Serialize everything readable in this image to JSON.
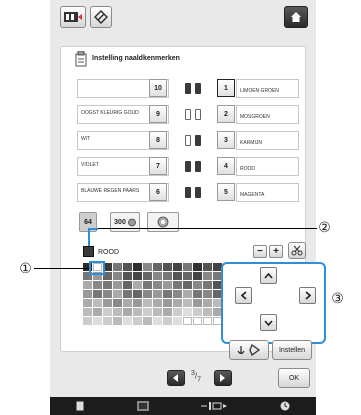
{
  "header": {
    "title": "Instelling naaldkenmerken"
  },
  "rows": [
    {
      "left_label": "",
      "left_num": "10",
      "right_num": "1",
      "right_label": "LIMOEN GROEN",
      "spools": [
        "dark",
        "dark"
      ]
    },
    {
      "left_label": "OOGST KLEURIG GOUD",
      "left_num": "9",
      "right_num": "2",
      "right_label": "MOSGROEN",
      "spools": [
        "light",
        "light"
      ]
    },
    {
      "left_label": "WIT",
      "left_num": "8",
      "right_num": "3",
      "right_label": "KARMIJN",
      "spools": [
        "light",
        "dark"
      ]
    },
    {
      "left_label": "VIOLET",
      "left_num": "7",
      "right_num": "4",
      "right_label": "ROOD",
      "spools": [
        "dark",
        "dark"
      ]
    },
    {
      "left_label": "BLAUWE REGEN PAARS",
      "left_num": "6",
      "right_num": "5",
      "right_label": "MAGENTA",
      "spools": [
        "dark",
        "dark"
      ]
    }
  ],
  "tabs": {
    "tab1": "64",
    "tab2": "300"
  },
  "selected_color": "ROOD",
  "buttons": {
    "minus": "−",
    "plus": "+",
    "instellen": "Instellen",
    "ok": "OK"
  },
  "pagination": {
    "current": "3",
    "total": "7"
  },
  "callouts": {
    "c1": "①",
    "c2": "②",
    "c3": "③"
  },
  "colors": {
    "accent_blue": "#2e8fd6",
    "selected_swatch": "#3a3a3a"
  },
  "palette": [
    "#2b2b2b",
    "#ffffff",
    "#3a3a3a",
    "#777777",
    "#555555",
    "#2e2e2e",
    "#888888",
    "#666666",
    "#555555",
    "#444444",
    "#777777",
    "#333333",
    "#555555",
    "#444444",
    "#777777",
    "#999999",
    "#666666",
    "#888888",
    "#555555",
    "#444444",
    "#666666",
    "#888888",
    "#777777",
    "#555555",
    "#666666",
    "#444444",
    "#888888",
    "#777777",
    "#aaaaaa",
    "#888888",
    "#777777",
    "#999999",
    "#666666",
    "#aaaaaa",
    "#777777",
    "#888888",
    "#999999",
    "#777777",
    "#666666",
    "#888888",
    "#777777",
    "#555555",
    "#999999",
    "#777777",
    "#888888",
    "#aaaaaa",
    "#777777",
    "#666666",
    "#888888",
    "#999999",
    "#777777",
    "#888888",
    "#aaaaaa",
    "#777777",
    "#888888",
    "#666666",
    "#aaaaaa",
    "#bbbbbb",
    "#999999",
    "#888888",
    "#aaaaaa",
    "#999999",
    "#bbbbbb",
    "#aaaaaa",
    "#999999",
    "#aaaaaa",
    "#bbbbbb",
    "#999999",
    "#aaaaaa",
    "#bbbbbb",
    "#bbbbbb",
    "#aaaaaa",
    "#cccccc",
    "#bbbbbb",
    "#aaaaaa",
    "#bbbbbb",
    "#cccccc",
    "#bbbbbb",
    "#aaaaaa",
    "#cccccc",
    "#dddddd",
    "#cccccc",
    "#bbbbbb",
    "#aaaaaa",
    "#cccccc",
    "#dddddd",
    "#cccccc",
    "#bbbbbb",
    "#dddddd",
    "#cccccc",
    "#bbbbbb",
    "#dddddd",
    "#cccccc",
    "#dddddd",
    "#ffffff",
    "#ffffff",
    "#ffffff",
    "#ffffff"
  ]
}
